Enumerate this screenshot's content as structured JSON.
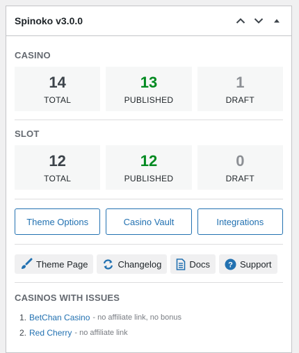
{
  "widget": {
    "title": "Spinoko v3.0.0",
    "header_icons": [
      "chevron-up-icon",
      "chevron-down-icon",
      "caret-up-icon"
    ]
  },
  "casino": {
    "title": "CASINO",
    "total": {
      "value": "14",
      "label": "TOTAL"
    },
    "published": {
      "value": "13",
      "label": "PUBLISHED"
    },
    "draft": {
      "value": "1",
      "label": "DRAFT"
    }
  },
  "slot": {
    "title": "SLOT",
    "total": {
      "value": "12",
      "label": "TOTAL"
    },
    "published": {
      "value": "12",
      "label": "PUBLISHED"
    },
    "draft": {
      "value": "0",
      "label": "DRAFT"
    }
  },
  "buttons": {
    "theme_options": "Theme Options",
    "casino_vault": "Casino Vault",
    "integrations": "Integrations"
  },
  "links": {
    "theme_page": {
      "label": "Theme Page",
      "icon": "brush-icon"
    },
    "changelog": {
      "label": "Changelog",
      "icon": "refresh-icon"
    },
    "docs": {
      "label": "Docs",
      "icon": "document-icon"
    },
    "support": {
      "label": "Support",
      "icon": "help-icon"
    }
  },
  "issues": {
    "title": "CASINOS WITH ISSUES",
    "items": [
      {
        "num": "1.",
        "name": "BetChan Casino",
        "note": "- no affiliate link, no bonus"
      },
      {
        "num": "2.",
        "name": "Red Cherry",
        "note": "- no affiliate link"
      }
    ]
  },
  "colors": {
    "accent": "#2271b1",
    "published": "#008a20",
    "draft": "#8c8f94",
    "total": "#3c434a"
  }
}
